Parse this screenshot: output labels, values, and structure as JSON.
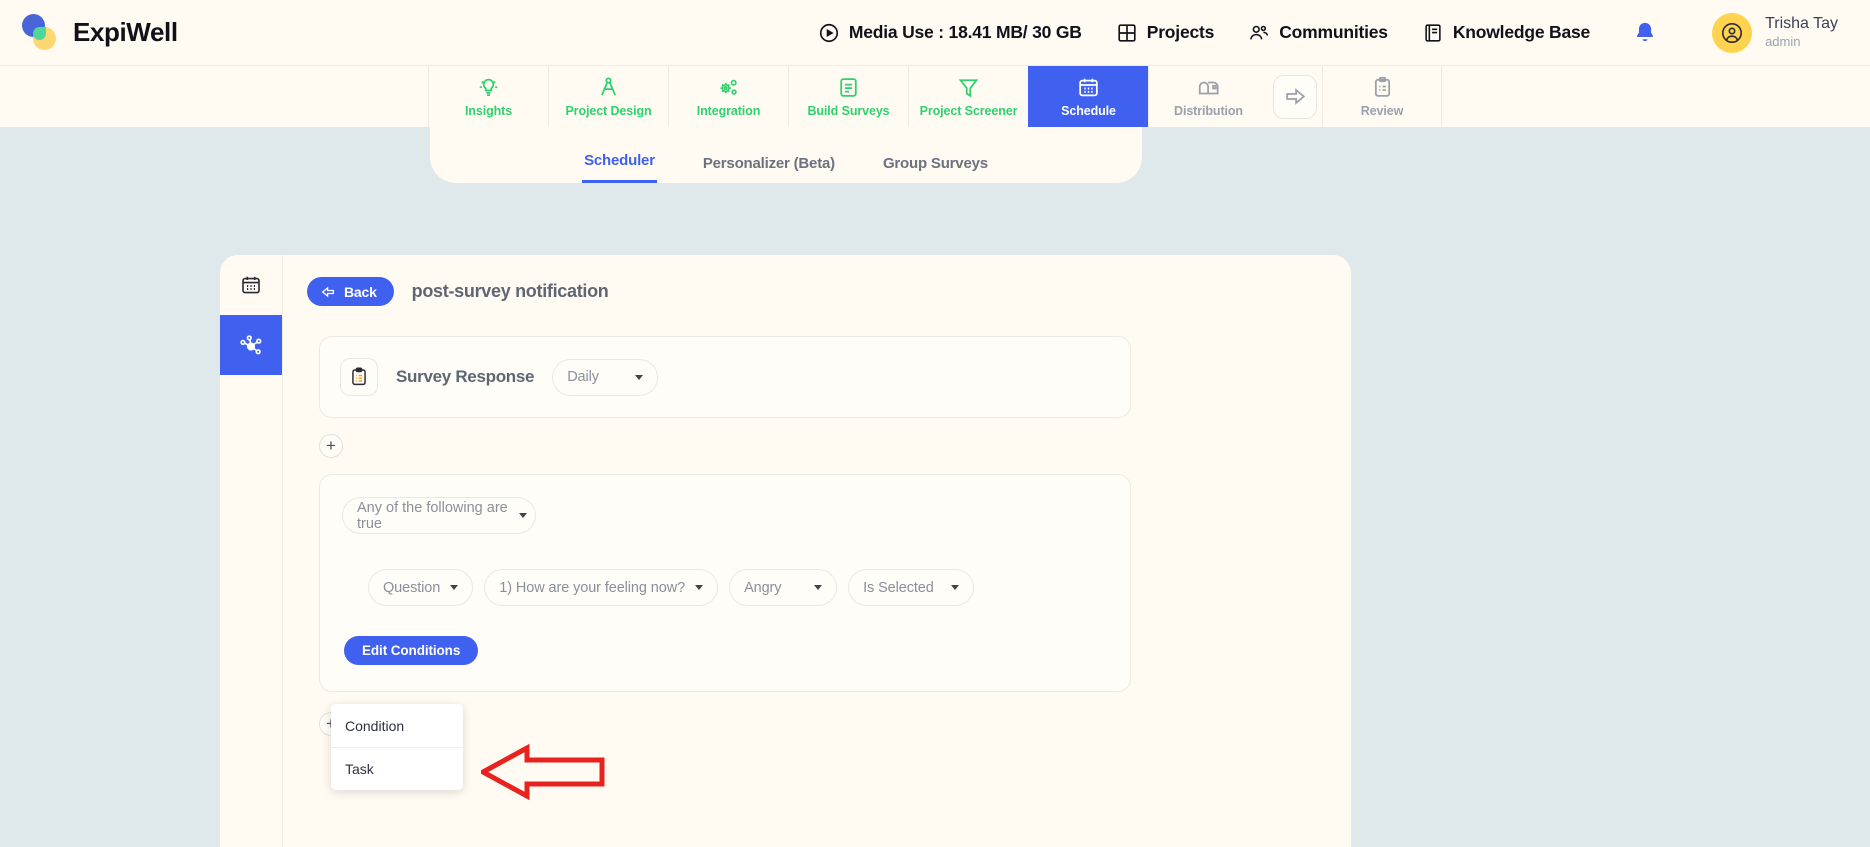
{
  "brand": {
    "name": "ExpiWell"
  },
  "header": {
    "items": [
      {
        "label": "Media Use : 18.41 MB/ 30 GB",
        "icon": "play-circle-icon"
      },
      {
        "label": "Projects",
        "icon": "grid-icon"
      },
      {
        "label": "Communities",
        "icon": "people-icon"
      },
      {
        "label": "Knowledge Base",
        "icon": "book-icon"
      }
    ],
    "notification_icon": "bell-icon",
    "user": {
      "name": "Trisha Tay",
      "role": "admin",
      "avatar_icon": "user-avatar-icon"
    }
  },
  "modules": [
    {
      "label": "Insights",
      "icon": "lightbulb-icon",
      "state": "default"
    },
    {
      "label": "Project Design",
      "icon": "compass-icon",
      "state": "default"
    },
    {
      "label": "Integration",
      "icon": "gears-icon",
      "state": "default"
    },
    {
      "label": "Build Surveys",
      "icon": "document-lines-icon",
      "state": "default"
    },
    {
      "label": "Project Screener",
      "icon": "funnel-icon",
      "state": "default"
    },
    {
      "label": "Schedule",
      "icon": "calendar-icon",
      "state": "active"
    },
    {
      "label": "Distribution",
      "icon": "mailbox-icon",
      "state": "disabled"
    },
    {
      "label": "Review",
      "icon": "clipboard-icon",
      "state": "disabled"
    }
  ],
  "module_arrow": {
    "icon": "arrow-right-icon"
  },
  "subtabs": [
    {
      "label": "Scheduler",
      "active": true
    },
    {
      "label": "Personalizer (Beta)",
      "active": false
    },
    {
      "label": "Group Surveys",
      "active": false
    }
  ],
  "rail": [
    {
      "icon": "calendar-icon",
      "active": false
    },
    {
      "icon": "workflow-nodes-icon",
      "active": true
    }
  ],
  "workflow": {
    "back_label": "Back",
    "title": "post-survey notification",
    "trigger": {
      "icon": "clipboard-list-icon",
      "label": "Survey Response",
      "frequency": "Daily"
    },
    "add_trigger_label": "+",
    "conditions": {
      "match_type": "Any of the following are true",
      "row": [
        {
          "name": "field-type",
          "value": "Question"
        },
        {
          "name": "question",
          "value": "1) How are your feeling now?"
        },
        {
          "name": "answer",
          "value": "Angry"
        },
        {
          "name": "operator",
          "value": "Is Selected"
        }
      ],
      "edit_label": "Edit Conditions"
    },
    "add_menu": {
      "plus_label": "+",
      "items": [
        {
          "label": "Condition"
        },
        {
          "label": "Task"
        }
      ]
    }
  },
  "colors": {
    "accent_blue": "#4060f0",
    "nav_green": "#2fd06e",
    "page_bg": "#dfe8ea",
    "card_bg": "#fffbf2",
    "annotation_red": "#e8221f",
    "avatar_yellow": "#ffd34d"
  }
}
